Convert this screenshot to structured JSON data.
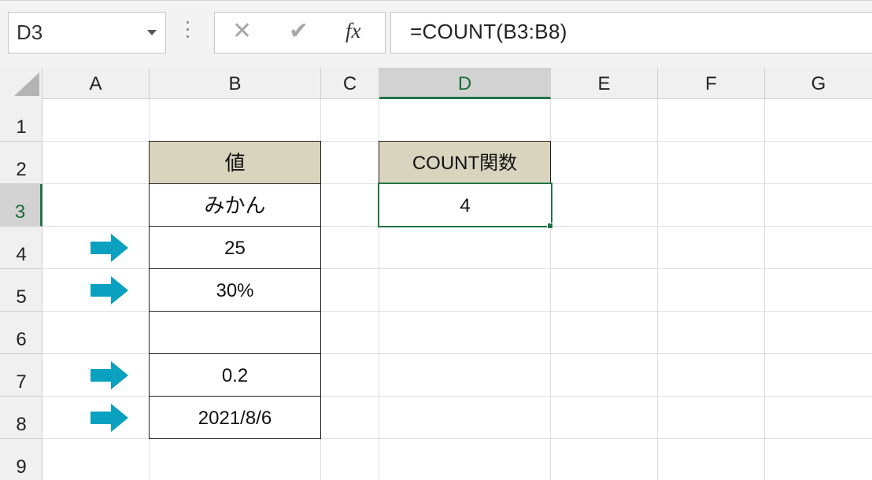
{
  "name_box": {
    "value": "D3"
  },
  "formula_bar": {
    "cancel_icon": "cancel-x-icon",
    "enter_icon": "check-icon",
    "fx_label": "fx",
    "formula": "=COUNT(B3:B8)"
  },
  "columns": [
    "A",
    "B",
    "C",
    "D",
    "E",
    "F",
    "G"
  ],
  "selected_column": "D",
  "rows": [
    "1",
    "2",
    "3",
    "4",
    "5",
    "6",
    "7",
    "8",
    "9"
  ],
  "selected_row": "3",
  "cells": {
    "B2": "値",
    "B3": "みかん",
    "B4": "25",
    "B5": "30%",
    "B6": "",
    "B7": "0.2",
    "B8": "2021/8/6",
    "D2": "COUNT関数",
    "D3": "4"
  },
  "arrows": {
    "rows": [
      "4",
      "5",
      "7",
      "8"
    ],
    "color": "#0aa0c0",
    "icon": "arrow-right-icon"
  },
  "colors": {
    "header_fill": "#d8d4bd",
    "selection": "#217346"
  }
}
